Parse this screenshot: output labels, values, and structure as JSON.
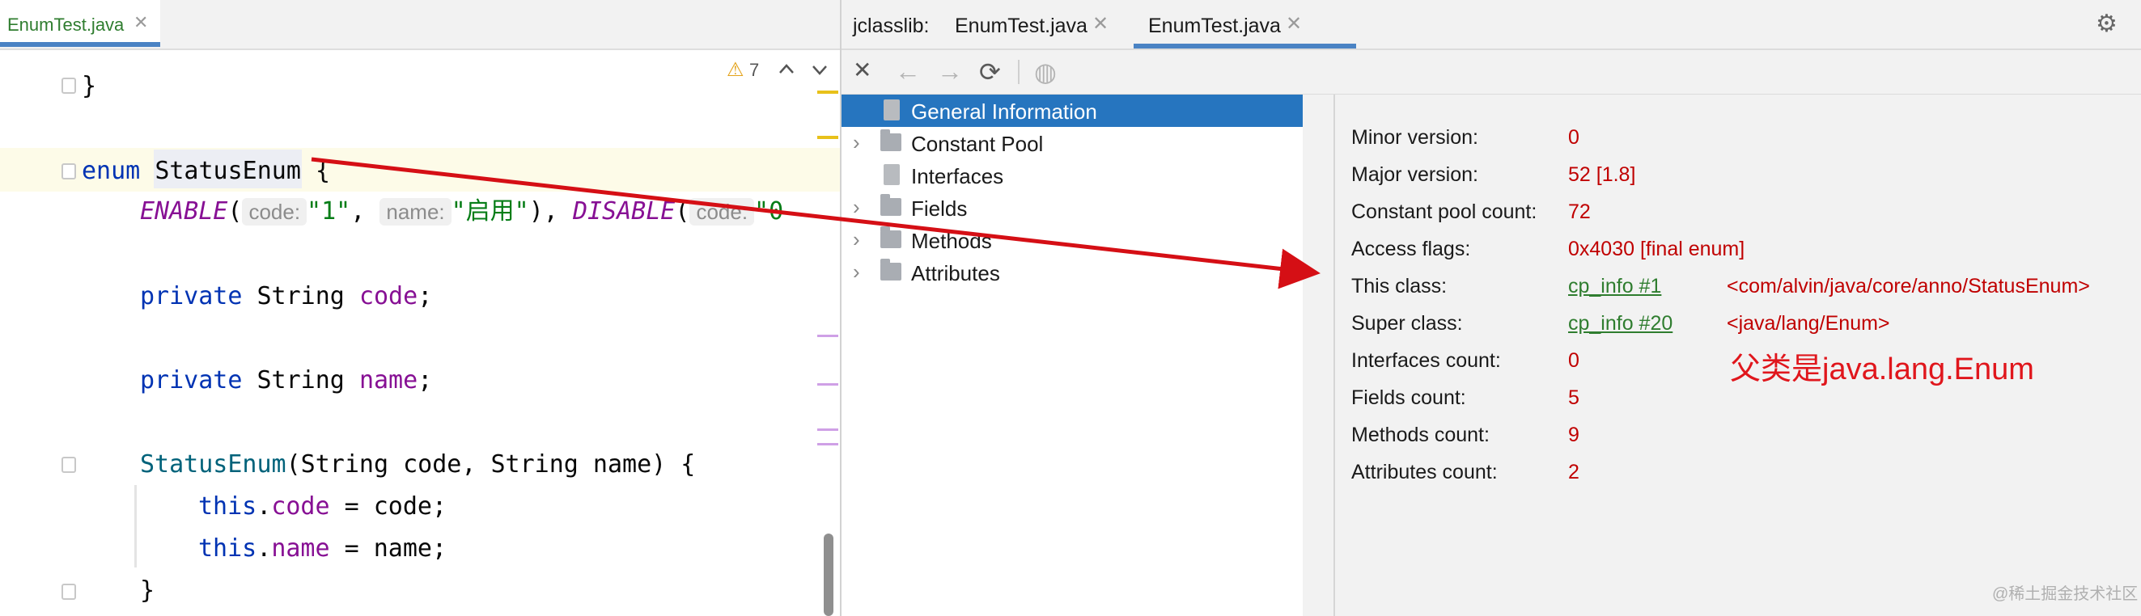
{
  "editor": {
    "tab_label": "EnumTest.java",
    "close_glyph": "✕",
    "warning_count": "7",
    "warning_glyph": "⚠",
    "lines": {
      "brace_close": "}",
      "enum_kw": "enum",
      "enum_name": "StatusEnum",
      "enum_brace": " {",
      "enable": "ENABLE",
      "paren_open": "(",
      "hint_code": "code:",
      "val_one": "\"1\"",
      "comma": ",",
      "hint_name": "name:",
      "val_enabled": "\"启用\"",
      "close_paren_comma": "),",
      "disable": "DISABLE",
      "hint_code2": "code:",
      "val_zero_partial": "\"0",
      "private_kw": "private",
      "string_type": "String",
      "field_code": "code",
      "field_name": "name",
      "semicolon": ";",
      "ctor_name": "StatusEnum",
      "ctor_params": "(String code, String name) {",
      "this_kw": "this",
      "assign_code": " = code;",
      "assign_name": " = name;",
      "dot": ".",
      "block_close": "}"
    }
  },
  "jclasslib": {
    "tab_prefix": "jclasslib:",
    "tabs": [
      {
        "label": "EnumTest.java"
      },
      {
        "label": "EnumTest.java"
      }
    ],
    "toolbar": {
      "close_icon": "✕",
      "back_icon": "←",
      "forward_icon": "→",
      "reload_icon": "⟳",
      "web_icon": "◍",
      "settings_icon": "⚙"
    },
    "tree": [
      {
        "label": "General Information",
        "selected": true,
        "expandable": false,
        "icon": "file-icon"
      },
      {
        "label": "Constant Pool",
        "selected": false,
        "expandable": true,
        "icon": "folder-icon"
      },
      {
        "label": "Interfaces",
        "selected": false,
        "expandable": false,
        "icon": "file-icon"
      },
      {
        "label": "Fields",
        "selected": false,
        "expandable": true,
        "icon": "folder-icon"
      },
      {
        "label": "Methods",
        "selected": false,
        "expandable": true,
        "icon": "folder-icon"
      },
      {
        "label": "Attributes",
        "selected": false,
        "expandable": true,
        "icon": "folder-icon"
      }
    ],
    "chevron": "›",
    "info": {
      "minor_version": {
        "label": "Minor version:",
        "value": "0"
      },
      "major_version": {
        "label": "Major version:",
        "value": "52 [1.8]"
      },
      "constant_pool_count": {
        "label": "Constant pool count:",
        "value": "72"
      },
      "access_flags": {
        "label": "Access flags:",
        "value": "0x4030 [final enum]"
      },
      "this_class": {
        "label": "This class:",
        "link": "cp_info #1",
        "value": "<com/alvin/java/core/anno/StatusEnum>"
      },
      "super_class": {
        "label": "Super class:",
        "link": "cp_info #20",
        "value": "<java/lang/Enum>"
      },
      "interfaces_count": {
        "label": "Interfaces count:",
        "value": "0"
      },
      "fields_count": {
        "label": "Fields count:",
        "value": "5"
      },
      "methods_count": {
        "label": "Methods count:",
        "value": "9"
      },
      "attributes_count": {
        "label": "Attributes count:",
        "value": "2"
      }
    }
  },
  "annotation": "父类是java.lang.Enum",
  "watermark": "@稀土掘金技术社区",
  "colors": {
    "arrow": "#d50f15",
    "selection": "#2675bf",
    "value_red": "#c00000",
    "link_green": "#2f7d2f"
  }
}
